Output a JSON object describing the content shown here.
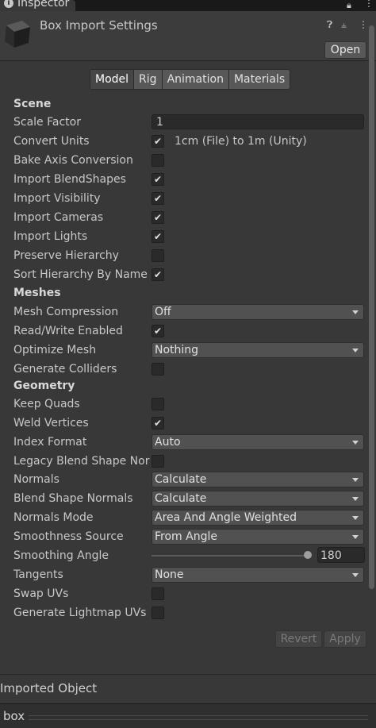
{
  "window": {
    "tab_label": "Inspector"
  },
  "header": {
    "title": "Box Import Settings",
    "open_button": "Open",
    "icons": [
      "help-icon",
      "presets-icon",
      "more-options-icon"
    ]
  },
  "tabs": [
    {
      "label": "Model",
      "active": true
    },
    {
      "label": "Rig",
      "active": false
    },
    {
      "label": "Animation",
      "active": false
    },
    {
      "label": "Materials",
      "active": false
    }
  ],
  "scene": {
    "heading": "Scene",
    "scale_factor": {
      "label": "Scale Factor",
      "value": "1"
    },
    "convert_units": {
      "label": "Convert Units",
      "checked": true,
      "note": "1cm (File) to 1m (Unity)"
    },
    "bake_axis": {
      "label": "Bake Axis Conversion",
      "checked": false
    },
    "import_blendshapes": {
      "label": "Import BlendShapes",
      "checked": true
    },
    "import_visibility": {
      "label": "Import Visibility",
      "checked": true
    },
    "import_cameras": {
      "label": "Import Cameras",
      "checked": true
    },
    "import_lights": {
      "label": "Import Lights",
      "checked": true
    },
    "preserve_hierarchy": {
      "label": "Preserve Hierarchy",
      "checked": false
    },
    "sort_hierarchy": {
      "label": "Sort Hierarchy By Name",
      "checked": true
    }
  },
  "meshes": {
    "heading": "Meshes",
    "mesh_compression": {
      "label": "Mesh Compression",
      "value": "Off"
    },
    "read_write": {
      "label": "Read/Write Enabled",
      "checked": true
    },
    "optimize_mesh": {
      "label": "Optimize Mesh",
      "value": "Nothing"
    },
    "generate_colliders": {
      "label": "Generate Colliders",
      "checked": false
    }
  },
  "geometry": {
    "heading": "Geometry",
    "keep_quads": {
      "label": "Keep Quads",
      "checked": false
    },
    "weld_vertices": {
      "label": "Weld Vertices",
      "checked": true
    },
    "index_format": {
      "label": "Index Format",
      "value": "Auto"
    },
    "legacy_blend": {
      "label": "Legacy Blend Shape Norm",
      "checked": false
    },
    "normals": {
      "label": "Normals",
      "value": "Calculate"
    },
    "blend_shape_normals": {
      "label": "Blend Shape Normals",
      "value": "Calculate"
    },
    "normals_mode": {
      "label": "Normals Mode",
      "value": "Area And Angle Weighted"
    },
    "smoothness_source": {
      "label": "Smoothness Source",
      "value": "From Angle"
    },
    "smoothing_angle": {
      "label": "Smoothing Angle",
      "value": "180",
      "slider_fraction": 1.0
    },
    "tangents": {
      "label": "Tangents",
      "value": "None"
    },
    "swap_uvs": {
      "label": "Swap UVs",
      "checked": false
    },
    "generate_lightmap_uvs": {
      "label": "Generate Lightmap UVs",
      "checked": false
    }
  },
  "actions": {
    "revert": "Revert",
    "apply": "Apply"
  },
  "imported_object": {
    "label": "Imported Object"
  },
  "footer": {
    "object_name": "box"
  }
}
